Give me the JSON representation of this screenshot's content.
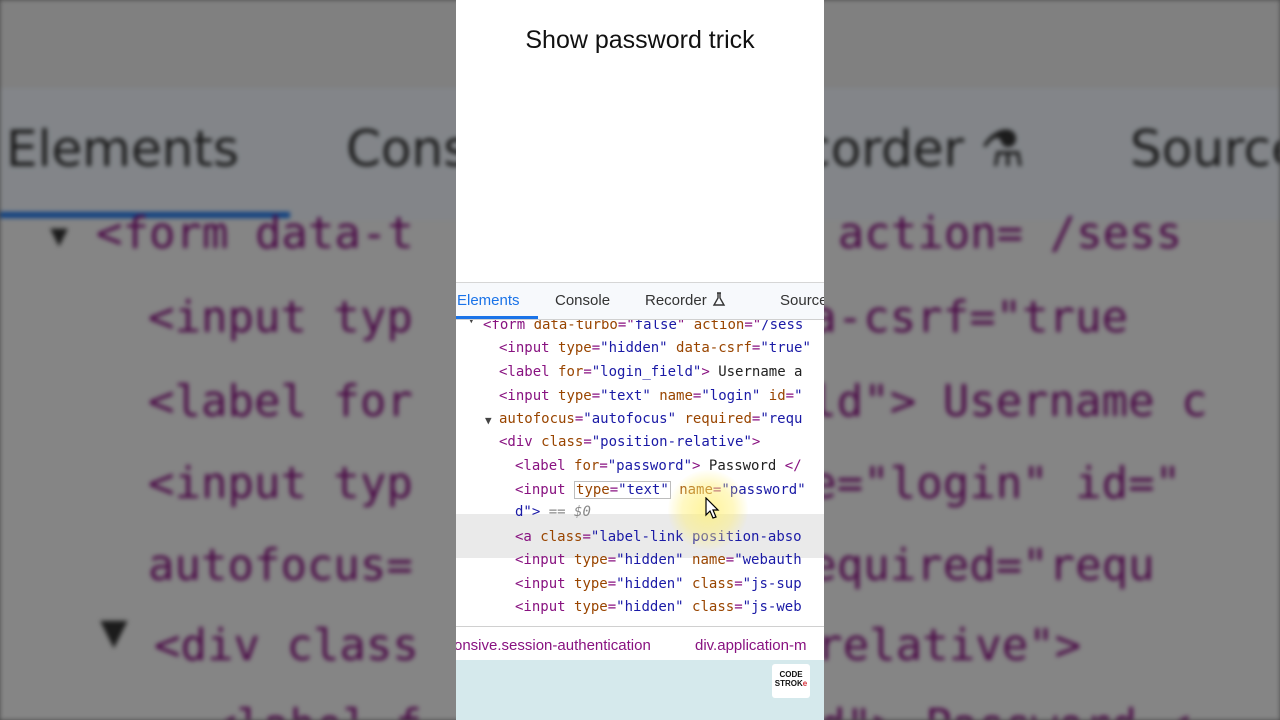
{
  "title": "Show password trick",
  "tabs": {
    "elements": "Elements",
    "console": "Console",
    "recorder": "Recorder",
    "sources": "Sources"
  },
  "code_lines": {
    "l0": {
      "tag_open": "<form ",
      "attr1": "data-turbo",
      "eq1": "=\"",
      "val1": "false",
      "mid": "\" ",
      "attr2": "action",
      "eq2": "=\"",
      "val2": "/sess"
    },
    "l1": {
      "tag": "<input ",
      "a1": "type",
      "v1": "\"hidden\"",
      "a2": "data-csrf",
      "v2": "\"true\""
    },
    "l2": {
      "tag": "<label ",
      "a1": "for",
      "v1": "\"login_field\"",
      "close": ">",
      "text": " Username a"
    },
    "l3": {
      "tag": "<input ",
      "a1": "type",
      "v1": "\"text\"",
      "a2": "name",
      "v2": "\"login\"",
      "a3": "id",
      "v3": "\""
    },
    "l4": {
      "a1": "autofocus",
      "v1": "\"autofocus\"",
      "a2": "required",
      "v2": "\"requ"
    },
    "l5": {
      "tag": "<div ",
      "a1": "class",
      "v1": "\"position-relative\"",
      "close": ">"
    },
    "l6": {
      "tag": "<label ",
      "a1": "for",
      "v1": "\"password\"",
      "close": ">",
      "text": " Password ",
      "end": "</"
    },
    "l7": {
      "tag": "<input ",
      "a1": "type",
      "v1": "\"text\"",
      "a2": "name",
      "v2": "\"password\""
    },
    "l8": {
      "cont": "d\">",
      "marker": " == $0"
    },
    "l9": {
      "tag": "<a ",
      "a1": "class",
      "v1": "\"label-link position-abso"
    },
    "l10": {
      "tag": "<input ",
      "a1": "type",
      "v1": "\"hidden\"",
      "a2": "name",
      "v2": "\"webauth"
    },
    "l11": {
      "tag": "<input ",
      "a1": "type",
      "v1": "\"hidden\"",
      "a2": "class",
      "v2": "\"js-sup"
    },
    "l12": {
      "tag": "<input ",
      "a1": "type",
      "v1": "\"hidden\"",
      "a2": "class",
      "v2": "\"js-web"
    }
  },
  "breadcrumbs": [
    "onsive.session-authentication",
    "div.application-m"
  ],
  "logo": {
    "line1": "CODE",
    "line2": "STROK",
    "line2_end": "e"
  },
  "colors": {
    "accent": "#1a73e8",
    "tag": "#881280",
    "attr_name": "#994500",
    "attr_value": "#1a1aa6",
    "bottom_bg": "#d5e9ec"
  }
}
